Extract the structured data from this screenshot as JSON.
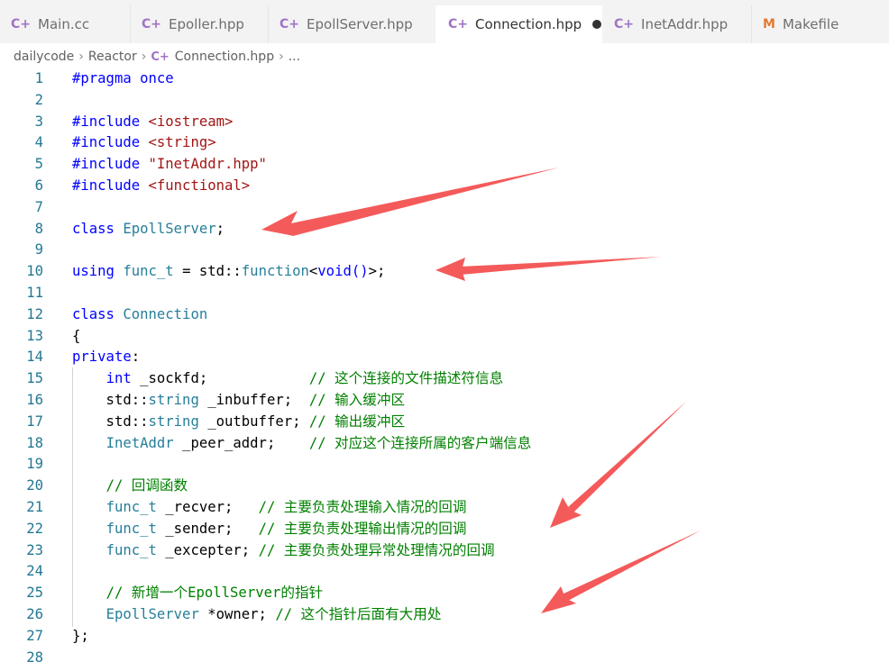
{
  "tabs": [
    {
      "label": "Main.cc",
      "icon": "cpp-file-icon",
      "active": false
    },
    {
      "label": "Epoller.hpp",
      "icon": "cpp-file-icon",
      "active": false
    },
    {
      "label": "EpollServer.hpp",
      "icon": "cpp-file-icon",
      "active": false
    },
    {
      "label": "Connection.hpp",
      "icon": "cpp-file-icon",
      "active": true,
      "modified": true
    },
    {
      "label": "InetAddr.hpp",
      "icon": "cpp-file-icon",
      "active": false
    },
    {
      "label": "Makefile",
      "icon": "makefile-icon",
      "active": false
    }
  ],
  "breadcrumb": {
    "items": [
      "dailycode",
      "Reactor",
      "Connection.hpp",
      "..."
    ]
  },
  "editor": {
    "lines": [
      {
        "n": "1",
        "text": "#pragma once"
      },
      {
        "n": "2",
        "text": ""
      },
      {
        "n": "3",
        "text": "#include <iostream>"
      },
      {
        "n": "4",
        "text": "#include <string>"
      },
      {
        "n": "5",
        "text": "#include \"InetAddr.hpp\""
      },
      {
        "n": "6",
        "text": "#include <functional>"
      },
      {
        "n": "7",
        "text": ""
      },
      {
        "n": "8",
        "text": "class EpollServer;"
      },
      {
        "n": "9",
        "text": ""
      },
      {
        "n": "10",
        "text": "using func_t = std::function<void()>;"
      },
      {
        "n": "11",
        "text": ""
      },
      {
        "n": "12",
        "text": "class Connection"
      },
      {
        "n": "13",
        "text": "{"
      },
      {
        "n": "14",
        "text": "private:"
      },
      {
        "n": "15",
        "text": "    int _sockfd;            // 这个连接的文件描述符信息"
      },
      {
        "n": "16",
        "text": "    std::string _inbuffer;  // 输入缓冲区"
      },
      {
        "n": "17",
        "text": "    std::string _outbuffer; // 输出缓冲区"
      },
      {
        "n": "18",
        "text": "    InetAddr _peer_addr;    // 对应这个连接所属的客户端信息"
      },
      {
        "n": "19",
        "text": ""
      },
      {
        "n": "20",
        "text": "    // 回调函数"
      },
      {
        "n": "21",
        "text": "    func_t _recver;   // 主要负责处理输入情况的回调"
      },
      {
        "n": "22",
        "text": "    func_t _sender;   // 主要负责处理输出情况的回调"
      },
      {
        "n": "23",
        "text": "    func_t _excepter; // 主要负责处理异常处理情况的回调"
      },
      {
        "n": "24",
        "text": ""
      },
      {
        "n": "25",
        "text": "    // 新增一个EpollServer的指针"
      },
      {
        "n": "26",
        "text": "    EpollServer *owner; // 这个指针后面有大用处"
      },
      {
        "n": "27",
        "text": "};"
      },
      {
        "n": "28",
        "text": ""
      }
    ]
  },
  "colors": {
    "keyword": "#0000ff",
    "type": "#267f99",
    "string": "#a31515",
    "comment": "#008000",
    "line_number": "#237893",
    "arrow": "#f45a5a"
  }
}
